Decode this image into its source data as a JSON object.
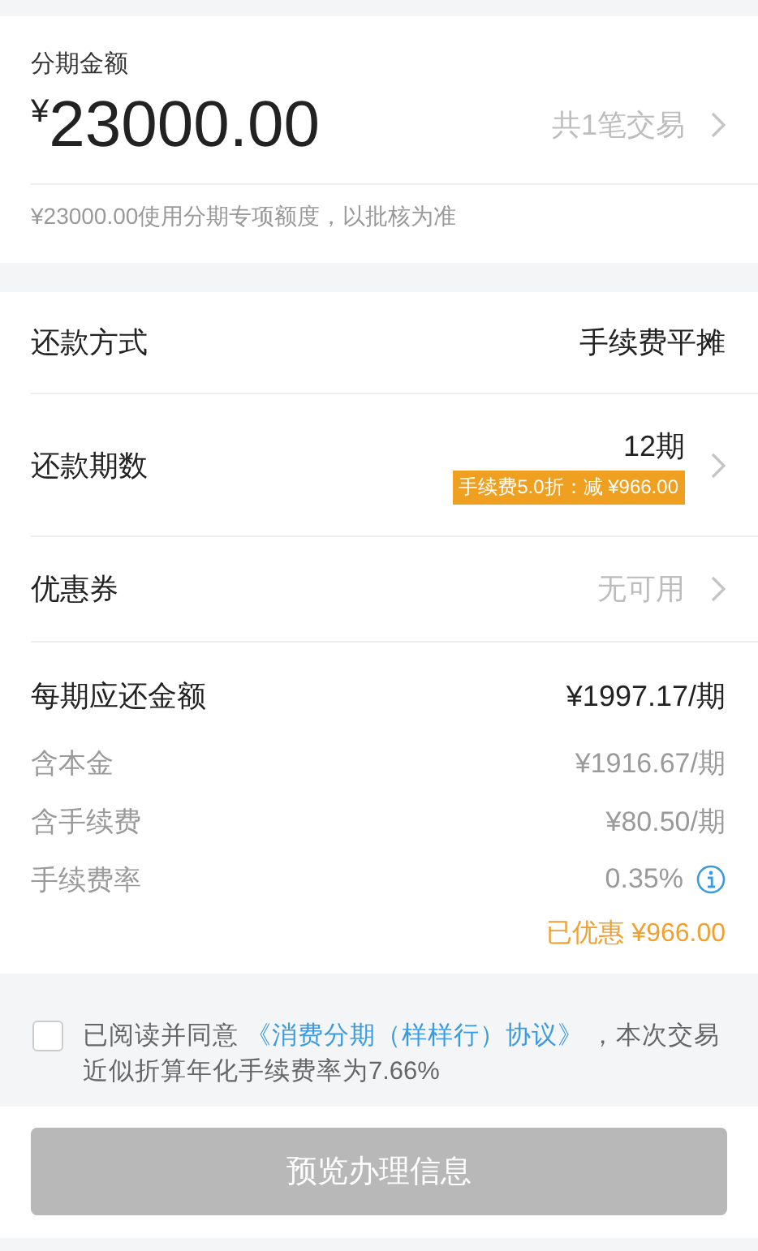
{
  "amount": {
    "label": "分期金额",
    "currency": "¥",
    "value": "23000.00",
    "transactions": "共1笔交易",
    "note": "¥23000.00使用分期专项额度，以批核为准"
  },
  "options": [
    {
      "kind": "plain",
      "label": "还款方式",
      "value": "手续费平摊"
    },
    {
      "kind": "badge",
      "label": "还款期数",
      "value": "12期",
      "badge": "手续费5.0折：减 ¥966.00"
    },
    {
      "kind": "muted",
      "label": "优惠券",
      "value": "无可用"
    }
  ],
  "repayment": {
    "label": "每期应还金额",
    "value": "¥1997.17/期",
    "items": [
      {
        "label": "含本金",
        "value": "¥1916.67/期",
        "info": false
      },
      {
        "label": "含手续费",
        "value": "¥80.50/期",
        "info": false
      },
      {
        "label": "手续费率",
        "value": "0.35%",
        "info": true
      }
    ],
    "saved": "已优惠 ¥966.00"
  },
  "agreement": {
    "checked": false,
    "before": "已阅读并同意 ",
    "link": "《消费分期（样样行）协议》",
    "after": " ，本次交易近似折算年化手续费率为7.66%"
  },
  "button": {
    "label": "预览办理信息",
    "disabled": true
  }
}
